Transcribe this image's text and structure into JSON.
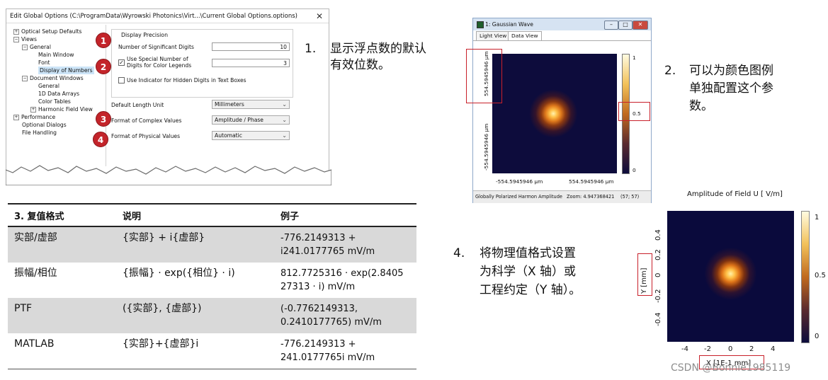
{
  "dialog": {
    "title": "Edit Global Options (C:\\ProgramData\\Wyrowski Photonics\\Virt...\\Current Global Options.options)",
    "close_glyph": "✕",
    "tree": {
      "optical_setup_defaults": "Optical Setup Defaults",
      "views": "Views",
      "general": "General",
      "main_window": "Main Window",
      "font": "Font",
      "display_of_numbers": "Display of Numbers",
      "document_windows": "Document Windows",
      "doc_general": "General",
      "data_arrays_1d": "1D Data Arrays",
      "color_tables": "Color Tables",
      "harmonic_field_view": "Harmonic Field View",
      "performance": "Performance",
      "optional_dialogs": "Optional Dialogs",
      "file_handling": "File Handling",
      "expand_plus": "+",
      "expand_minus": "−"
    },
    "group_title": "Display Precision",
    "significant_digits_label": "Number of Significant Digits",
    "significant_digits_value": "10",
    "special_digits_label_1": "Use Special Number of",
    "special_digits_label_2": "Digits for Color Legends",
    "special_digits_checked": "✓",
    "special_digits_value": "3",
    "hidden_digits_label": "Use Indicator for Hidden Digits in Text Boxes",
    "length_unit_label": "Default Length Unit",
    "length_unit_value": "Millimeters",
    "complex_label": "Format of Complex Values",
    "complex_value": "Amplitude / Phase",
    "physical_label": "Format of Physical Values",
    "physical_value": "Automatic",
    "dropdown_glyph": "⌄",
    "badges": [
      "1",
      "2",
      "3",
      "4"
    ]
  },
  "table": {
    "headers": [
      "3. 复值格式",
      "说明",
      "例子"
    ],
    "rows": [
      {
        "format": "实部/虚部",
        "desc": "{实部} + i{虚部}",
        "example_1": "-776.2149313 +",
        "example_2": "i241.0177765 mV/m"
      },
      {
        "format": "振幅/相位",
        "desc": "{振幅} · exp({相位} · i)",
        "example_1": "812.7725316 · exp(2.8405",
        "example_2": "27313 · i) mV/m"
      },
      {
        "format": "PTF",
        "desc": "({实部}, {虚部})",
        "example_1": "(-0.7762149313,",
        "example_2": "0.2410177765) mV/m"
      },
      {
        "format": "MATLAB",
        "desc": "{实部}+{虚部}i",
        "example_1": "-776.2149313 +",
        "example_2": "241.0177765i mV/m"
      }
    ]
  },
  "notes": {
    "n1_num": "1.",
    "n1_l1": "显示浮点数的默认",
    "n1_l2": "有效位数。",
    "n2_num": "2.",
    "n2_l1": "可以为颜色图例",
    "n2_l2": "单独配置这个参",
    "n2_l3": "数。",
    "n4_num": "4.",
    "n4_l1": "将物理值格式设置",
    "n4_l2": "为科学（X 轴）或",
    "n4_l3": "工程约定（Y 轴）。"
  },
  "gaussian_window": {
    "title": "1: Gaussian Wave",
    "btn_min": "–",
    "btn_max": "□",
    "btn_close": "✕",
    "tabs": [
      "Light View",
      "Data View"
    ],
    "y_label_top": "554.5945946 µm",
    "y_label_bottom": "-554.5945946 µm",
    "x_label_left": "-554.5945946 µm",
    "x_label_right": "554.5945946 µm",
    "legend_ticks": [
      "1",
      "0.5",
      "0"
    ],
    "status_mode": "Globally Polarized Harmon Amplitude",
    "status_zoom": "Zoom: 4.947368421",
    "status_coords": "(57; 57)"
  },
  "plot2": {
    "title": "Amplitude of Field U  [ V/m]",
    "y_ticks": [
      "0.4",
      "0.2",
      "0",
      "-0.2",
      "-0.4"
    ],
    "x_ticks": [
      "-4",
      "-2",
      "0",
      "2",
      "4"
    ],
    "y_label": "Y [mm]",
    "x_label": "X [1E-1 mm]",
    "legend_ticks": [
      "1",
      "0.5",
      "0"
    ]
  },
  "watermark": "CSDN @Bonnie1985119",
  "colors": {
    "badge_red": "#c3242a",
    "highlight_red": "#c8202a",
    "row_gray": "#d9d9d9",
    "plot_dark": "#0a0a3c",
    "plot_hot": "#ffd060",
    "tree_selected": "#cce4f7"
  },
  "icons": {
    "badge": "numbered-red-circle",
    "window_app_icon": "green-square-icon"
  }
}
